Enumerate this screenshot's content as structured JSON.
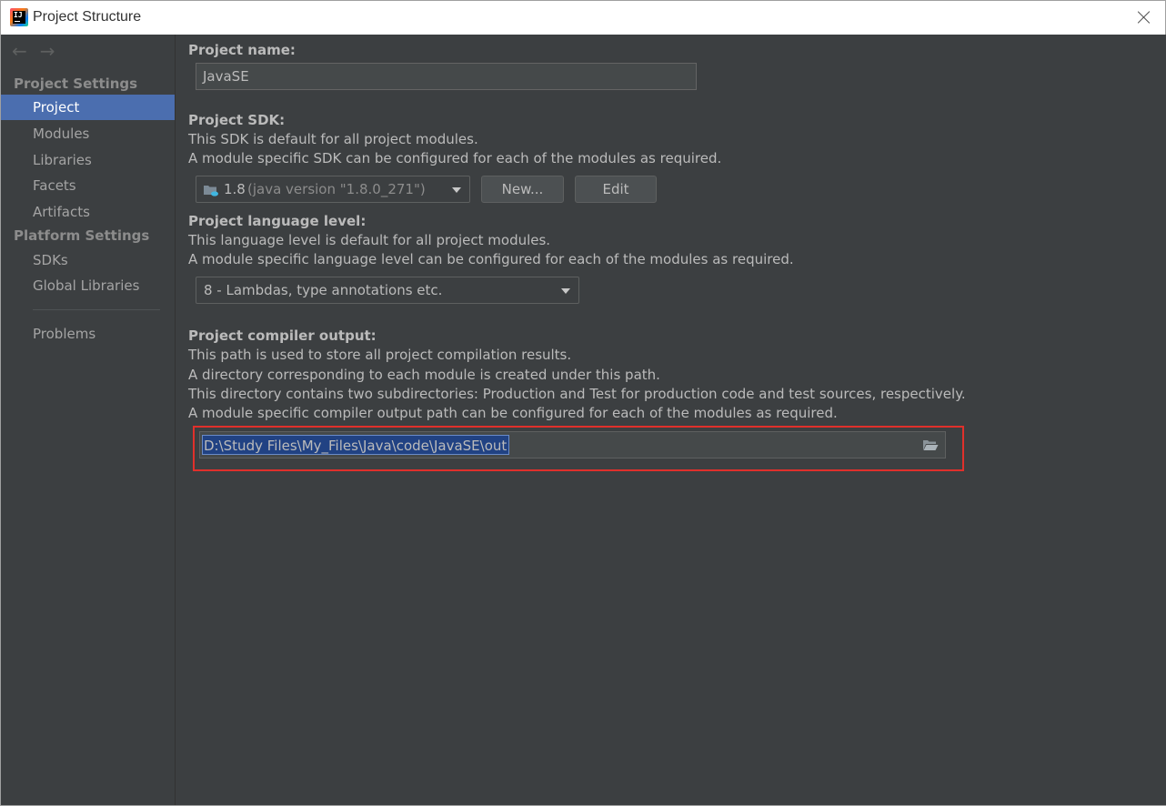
{
  "window": {
    "title": "Project Structure"
  },
  "sidebar": {
    "project_settings_header": "Project Settings",
    "platform_settings_header": "Platform Settings",
    "items": [
      {
        "label": "Project",
        "selected": true
      },
      {
        "label": "Modules"
      },
      {
        "label": "Libraries"
      },
      {
        "label": "Facets"
      },
      {
        "label": "Artifacts"
      },
      {
        "label": "SDKs"
      },
      {
        "label": "Global Libraries"
      },
      {
        "label": "Problems"
      }
    ]
  },
  "main": {
    "project_name": {
      "label": "Project name:",
      "value": "JavaSE"
    },
    "project_sdk": {
      "label": "Project SDK:",
      "desc1": "This SDK is default for all project modules.",
      "desc2": "A module specific SDK can be configured for each of the modules as required.",
      "selected_version": "1.8",
      "selected_detail": "(java version \"1.8.0_271\")",
      "new_button": "New...",
      "edit_button": "Edit"
    },
    "language_level": {
      "label": "Project language level:",
      "desc1": "This language level is default for all project modules.",
      "desc2": "A module specific language level can be configured for each of the modules as required.",
      "selected": "8 - Lambdas, type annotations etc."
    },
    "compiler_output": {
      "label": "Project compiler output:",
      "desc1": "This path is used to store all project compilation results.",
      "desc2": "A directory corresponding to each module is created under this path.",
      "desc3": "This directory contains two subdirectories: Production and Test for production code and test sources, respectively.",
      "desc4": "A module specific compiler output path can be configured for each of the modules as required.",
      "path": "D:\\Study Files\\My_Files\\Java\\code\\JavaSE\\out"
    }
  },
  "colors": {
    "background": "#3c3f41",
    "selection": "#4b6eaf",
    "highlight_border": "#e0302b",
    "text_selection": "#214283"
  }
}
